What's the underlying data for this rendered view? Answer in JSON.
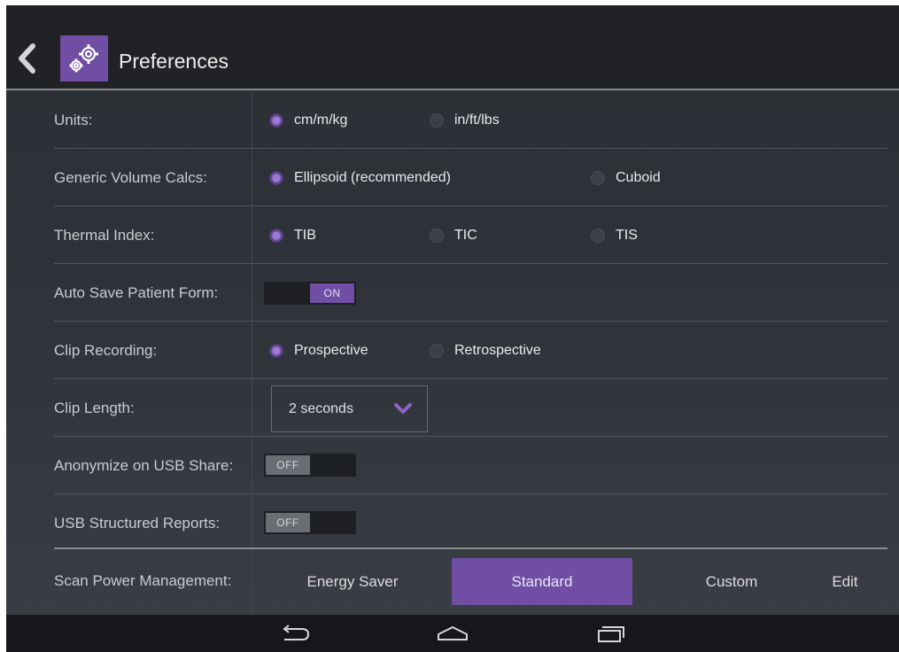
{
  "header": {
    "title": "Preferences"
  },
  "settings": {
    "units": {
      "label": "Units:",
      "options": [
        {
          "label": "cm/m/kg",
          "selected": true
        },
        {
          "label": "in/ft/lbs",
          "selected": false
        }
      ]
    },
    "volume": {
      "label": "Generic Volume Calcs:",
      "options": [
        {
          "label": "Ellipsoid (recommended)",
          "selected": true
        },
        {
          "label": "Cuboid",
          "selected": false
        }
      ]
    },
    "thermal": {
      "label": "Thermal Index:",
      "options": [
        {
          "label": "TIB",
          "selected": true
        },
        {
          "label": "TIC",
          "selected": false
        },
        {
          "label": "TIS",
          "selected": false
        }
      ]
    },
    "auto_save": {
      "label": "Auto Save Patient Form:",
      "state": "ON"
    },
    "clip_recording": {
      "label": "Clip Recording:",
      "options": [
        {
          "label": "Prospective",
          "selected": true
        },
        {
          "label": "Retrospective",
          "selected": false
        }
      ]
    },
    "clip_length": {
      "label": "Clip Length:",
      "value": "2 seconds"
    },
    "anonymize": {
      "label": "Anonymize on USB Share:",
      "state": "OFF"
    },
    "usb_reports": {
      "label": "USB Structured Reports:",
      "state": "OFF"
    },
    "scan_power": {
      "label": "Scan Power Management:",
      "options": [
        "Energy Saver",
        "Standard",
        "Custom"
      ],
      "selected": "Standard",
      "edit_label": "Edit"
    }
  },
  "colors": {
    "accent": "#6f4ea3",
    "background": "#30343a",
    "header": "#202226"
  },
  "icons": {
    "back": "chevron-left-icon",
    "app": "gears-icon",
    "nav_back": "nav-back-icon",
    "nav_home": "nav-home-icon",
    "nav_recents": "nav-recents-icon"
  }
}
